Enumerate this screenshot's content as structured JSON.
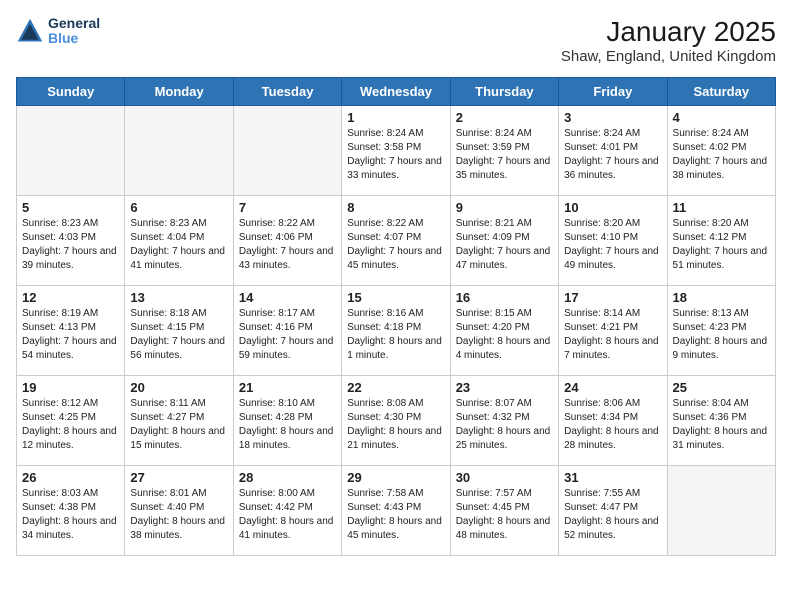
{
  "logo": {
    "line1": "General",
    "line2": "Blue"
  },
  "title": "January 2025",
  "subtitle": "Shaw, England, United Kingdom",
  "headers": [
    "Sunday",
    "Monday",
    "Tuesday",
    "Wednesday",
    "Thursday",
    "Friday",
    "Saturday"
  ],
  "weeks": [
    [
      {
        "day": "",
        "sunrise": "",
        "sunset": "",
        "daylight": ""
      },
      {
        "day": "",
        "sunrise": "",
        "sunset": "",
        "daylight": ""
      },
      {
        "day": "",
        "sunrise": "",
        "sunset": "",
        "daylight": ""
      },
      {
        "day": "1",
        "sunrise": "Sunrise: 8:24 AM",
        "sunset": "Sunset: 3:58 PM",
        "daylight": "Daylight: 7 hours and 33 minutes."
      },
      {
        "day": "2",
        "sunrise": "Sunrise: 8:24 AM",
        "sunset": "Sunset: 3:59 PM",
        "daylight": "Daylight: 7 hours and 35 minutes."
      },
      {
        "day": "3",
        "sunrise": "Sunrise: 8:24 AM",
        "sunset": "Sunset: 4:01 PM",
        "daylight": "Daylight: 7 hours and 36 minutes."
      },
      {
        "day": "4",
        "sunrise": "Sunrise: 8:24 AM",
        "sunset": "Sunset: 4:02 PM",
        "daylight": "Daylight: 7 hours and 38 minutes."
      }
    ],
    [
      {
        "day": "5",
        "sunrise": "Sunrise: 8:23 AM",
        "sunset": "Sunset: 4:03 PM",
        "daylight": "Daylight: 7 hours and 39 minutes."
      },
      {
        "day": "6",
        "sunrise": "Sunrise: 8:23 AM",
        "sunset": "Sunset: 4:04 PM",
        "daylight": "Daylight: 7 hours and 41 minutes."
      },
      {
        "day": "7",
        "sunrise": "Sunrise: 8:22 AM",
        "sunset": "Sunset: 4:06 PM",
        "daylight": "Daylight: 7 hours and 43 minutes."
      },
      {
        "day": "8",
        "sunrise": "Sunrise: 8:22 AM",
        "sunset": "Sunset: 4:07 PM",
        "daylight": "Daylight: 7 hours and 45 minutes."
      },
      {
        "day": "9",
        "sunrise": "Sunrise: 8:21 AM",
        "sunset": "Sunset: 4:09 PM",
        "daylight": "Daylight: 7 hours and 47 minutes."
      },
      {
        "day": "10",
        "sunrise": "Sunrise: 8:20 AM",
        "sunset": "Sunset: 4:10 PM",
        "daylight": "Daylight: 7 hours and 49 minutes."
      },
      {
        "day": "11",
        "sunrise": "Sunrise: 8:20 AM",
        "sunset": "Sunset: 4:12 PM",
        "daylight": "Daylight: 7 hours and 51 minutes."
      }
    ],
    [
      {
        "day": "12",
        "sunrise": "Sunrise: 8:19 AM",
        "sunset": "Sunset: 4:13 PM",
        "daylight": "Daylight: 7 hours and 54 minutes."
      },
      {
        "day": "13",
        "sunrise": "Sunrise: 8:18 AM",
        "sunset": "Sunset: 4:15 PM",
        "daylight": "Daylight: 7 hours and 56 minutes."
      },
      {
        "day": "14",
        "sunrise": "Sunrise: 8:17 AM",
        "sunset": "Sunset: 4:16 PM",
        "daylight": "Daylight: 7 hours and 59 minutes."
      },
      {
        "day": "15",
        "sunrise": "Sunrise: 8:16 AM",
        "sunset": "Sunset: 4:18 PM",
        "daylight": "Daylight: 8 hours and 1 minute."
      },
      {
        "day": "16",
        "sunrise": "Sunrise: 8:15 AM",
        "sunset": "Sunset: 4:20 PM",
        "daylight": "Daylight: 8 hours and 4 minutes."
      },
      {
        "day": "17",
        "sunrise": "Sunrise: 8:14 AM",
        "sunset": "Sunset: 4:21 PM",
        "daylight": "Daylight: 8 hours and 7 minutes."
      },
      {
        "day": "18",
        "sunrise": "Sunrise: 8:13 AM",
        "sunset": "Sunset: 4:23 PM",
        "daylight": "Daylight: 8 hours and 9 minutes."
      }
    ],
    [
      {
        "day": "19",
        "sunrise": "Sunrise: 8:12 AM",
        "sunset": "Sunset: 4:25 PM",
        "daylight": "Daylight: 8 hours and 12 minutes."
      },
      {
        "day": "20",
        "sunrise": "Sunrise: 8:11 AM",
        "sunset": "Sunset: 4:27 PM",
        "daylight": "Daylight: 8 hours and 15 minutes."
      },
      {
        "day": "21",
        "sunrise": "Sunrise: 8:10 AM",
        "sunset": "Sunset: 4:28 PM",
        "daylight": "Daylight: 8 hours and 18 minutes."
      },
      {
        "day": "22",
        "sunrise": "Sunrise: 8:08 AM",
        "sunset": "Sunset: 4:30 PM",
        "daylight": "Daylight: 8 hours and 21 minutes."
      },
      {
        "day": "23",
        "sunrise": "Sunrise: 8:07 AM",
        "sunset": "Sunset: 4:32 PM",
        "daylight": "Daylight: 8 hours and 25 minutes."
      },
      {
        "day": "24",
        "sunrise": "Sunrise: 8:06 AM",
        "sunset": "Sunset: 4:34 PM",
        "daylight": "Daylight: 8 hours and 28 minutes."
      },
      {
        "day": "25",
        "sunrise": "Sunrise: 8:04 AM",
        "sunset": "Sunset: 4:36 PM",
        "daylight": "Daylight: 8 hours and 31 minutes."
      }
    ],
    [
      {
        "day": "26",
        "sunrise": "Sunrise: 8:03 AM",
        "sunset": "Sunset: 4:38 PM",
        "daylight": "Daylight: 8 hours and 34 minutes."
      },
      {
        "day": "27",
        "sunrise": "Sunrise: 8:01 AM",
        "sunset": "Sunset: 4:40 PM",
        "daylight": "Daylight: 8 hours and 38 minutes."
      },
      {
        "day": "28",
        "sunrise": "Sunrise: 8:00 AM",
        "sunset": "Sunset: 4:42 PM",
        "daylight": "Daylight: 8 hours and 41 minutes."
      },
      {
        "day": "29",
        "sunrise": "Sunrise: 7:58 AM",
        "sunset": "Sunset: 4:43 PM",
        "daylight": "Daylight: 8 hours and 45 minutes."
      },
      {
        "day": "30",
        "sunrise": "Sunrise: 7:57 AM",
        "sunset": "Sunset: 4:45 PM",
        "daylight": "Daylight: 8 hours and 48 minutes."
      },
      {
        "day": "31",
        "sunrise": "Sunrise: 7:55 AM",
        "sunset": "Sunset: 4:47 PM",
        "daylight": "Daylight: 8 hours and 52 minutes."
      },
      {
        "day": "",
        "sunrise": "",
        "sunset": "",
        "daylight": ""
      }
    ]
  ]
}
